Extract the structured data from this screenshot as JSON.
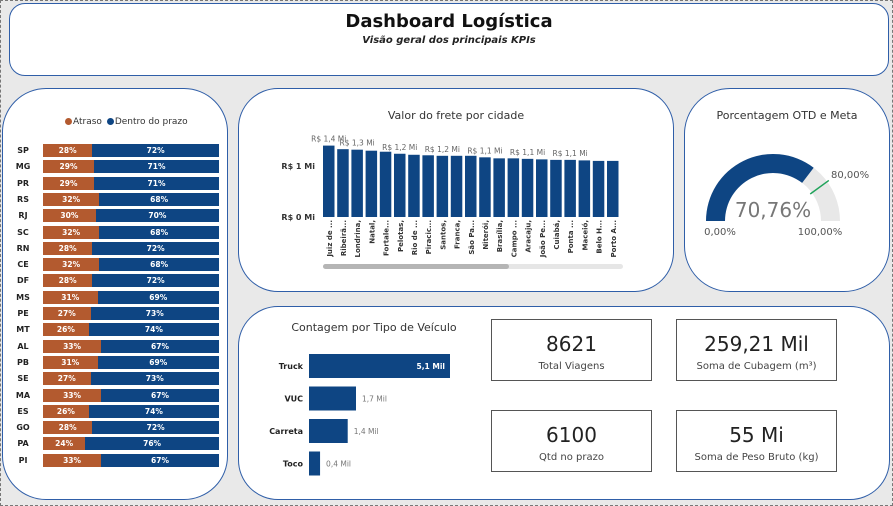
{
  "header": {
    "title": "Dashboard Logística",
    "subtitle": "Visão geral dos principais KPIs"
  },
  "states_chart": {
    "legend": [
      {
        "label": "Atraso",
        "color": "#b35a2f"
      },
      {
        "label": "Dentro do prazo",
        "color": "#0e4583"
      }
    ]
  },
  "freight_chart": {
    "title": "Valor do frete por cidade"
  },
  "gauge": {
    "title": "Porcentagem OTD e Meta",
    "value": 70.76,
    "value_label": "70,76%",
    "target": 80,
    "target_label": "80,00%",
    "min_label": "0,00%",
    "max_label": "100,00%"
  },
  "vehicles_chart": {
    "title": "Contagem por Tipo de Veículo"
  },
  "kpis": [
    {
      "value": "8621",
      "label": "Total Viagens"
    },
    {
      "value": "259,21 Mil",
      "label": "Soma de Cubagem (m³)"
    },
    {
      "value": "6100",
      "label": "Qtd no prazo"
    },
    {
      "value": "55 Mi",
      "label": "Soma de Peso Bruto (kg)"
    }
  ],
  "chart_data": [
    {
      "type": "bar",
      "orientation": "horizontal-stacked-100",
      "legend_position": "top",
      "series": [
        {
          "name": "Atraso"
        },
        {
          "name": "Dentro do prazo"
        }
      ],
      "categories": [
        "SP",
        "MG",
        "PR",
        "RS",
        "RJ",
        "SC",
        "RN",
        "CE",
        "DF",
        "MS",
        "PE",
        "MT",
        "AL",
        "PB",
        "SE",
        "MA",
        "ES",
        "GO",
        "PA",
        "PI"
      ],
      "late_labels": [
        "28%",
        "29%",
        "29%",
        "32%",
        "30%",
        "32%",
        "28%",
        "32%",
        "28%",
        "31%",
        "27%",
        "26%",
        "33%",
        "31%",
        "27%",
        "33%",
        "26%",
        "28%",
        "24%",
        "33%"
      ],
      "ontime_labels": [
        "72%",
        "71%",
        "71%",
        "68%",
        "70%",
        "68%",
        "72%",
        "68%",
        "72%",
        "69%",
        "73%",
        "74%",
        "67%",
        "69%",
        "73%",
        "67%",
        "74%",
        "72%",
        "76%",
        "67%"
      ],
      "late_values": [
        28,
        29,
        29,
        32,
        30,
        32,
        28,
        32,
        28,
        31,
        27,
        26,
        33,
        31,
        27,
        33,
        26,
        28,
        24,
        33
      ],
      "ontime_values": [
        72,
        71,
        71,
        68,
        70,
        68,
        72,
        68,
        72,
        69,
        73,
        74,
        67,
        69,
        73,
        67,
        74,
        72,
        76,
        67
      ]
    },
    {
      "type": "bar",
      "title": "Valor do frete por cidade",
      "y_ticks": [
        "R$ 0 Mi",
        "R$ 1 Mi"
      ],
      "categories": [
        "Juiz de ...",
        "Ribeirã...",
        "Londrina,",
        "Natal,",
        "Fortale...",
        "Pelotas,",
        "Rio de ...",
        "Piracic...",
        "Santos,",
        "Franca,",
        "São Pa...",
        "Niterói,",
        "Brasília,",
        "Campo ...",
        "Aracaju,",
        "João Pe...",
        "Cuiabá,",
        "Ponta ...",
        "Maceió,",
        "Belo H...",
        "Porto A..."
      ],
      "values": [
        1.4,
        1.33,
        1.32,
        1.3,
        1.28,
        1.24,
        1.22,
        1.21,
        1.2,
        1.2,
        1.2,
        1.17,
        1.15,
        1.15,
        1.14,
        1.13,
        1.12,
        1.12,
        1.11,
        1.1,
        1.1
      ],
      "labels": [
        "R$ 1,4 Mi",
        "",
        "R$ 1,3 Mi",
        "",
        "",
        "R$ 1,2 Mi",
        "",
        "",
        "R$ 1,2 Mi",
        "",
        "",
        "R$ 1,1 Mi",
        "",
        "",
        "R$ 1,1 Mi",
        "",
        "",
        "R$ 1,1 Mi",
        "",
        "",
        ""
      ],
      "ylim": [
        0,
        1.5
      ]
    },
    {
      "type": "bar",
      "orientation": "horizontal",
      "title": "Contagem por Tipo de Veículo",
      "categories": [
        "Truck",
        "VUC",
        "Carreta",
        "Toco"
      ],
      "values": [
        5.1,
        1.7,
        1.4,
        0.4
      ],
      "labels": [
        "5,1 Mil",
        "1,7 Mil",
        "1,4 Mil",
        "0,4 Mil"
      ]
    }
  ]
}
